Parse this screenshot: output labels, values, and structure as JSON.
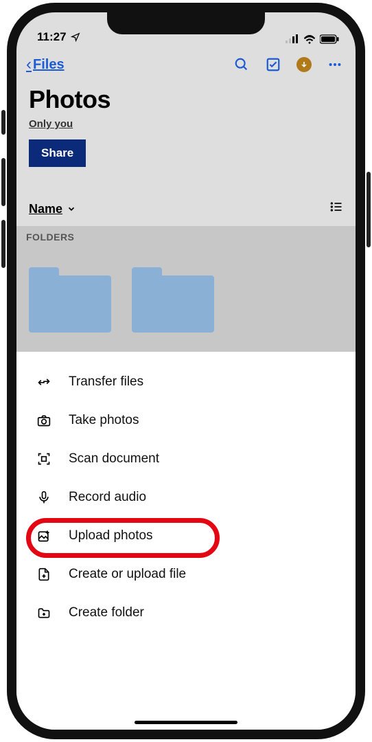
{
  "status": {
    "time": "11:27"
  },
  "nav": {
    "back_label": "Files",
    "title": "Photos",
    "subtitle": "Only you",
    "share_label": "Share"
  },
  "sort": {
    "label": "Name"
  },
  "section": {
    "folders_header": "FOLDERS"
  },
  "sheet": {
    "items": [
      {
        "label": "Transfer files"
      },
      {
        "label": "Take photos"
      },
      {
        "label": "Scan document"
      },
      {
        "label": "Record audio"
      },
      {
        "label": "Upload photos"
      },
      {
        "label": "Create or upload file"
      },
      {
        "label": "Create folder"
      }
    ]
  },
  "annotation": {
    "highlighted_item_index": 4
  }
}
